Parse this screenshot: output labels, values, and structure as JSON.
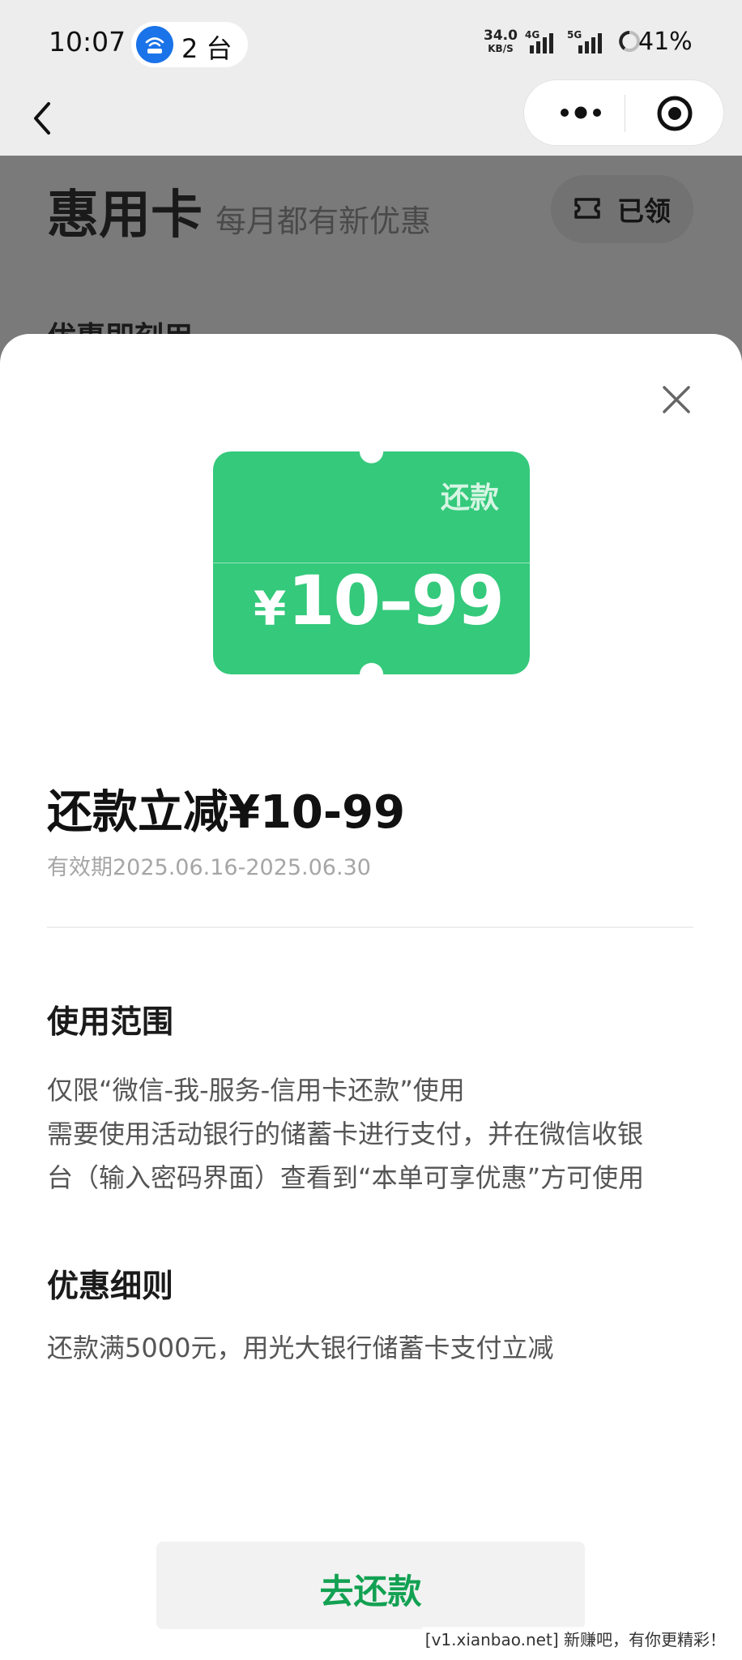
{
  "status_bar": {
    "time": "10:07",
    "device_count": "2 台",
    "net_speed_value": "34.0",
    "net_speed_unit": "KB/S",
    "sig1_label": "4G",
    "sig2_label": "5G",
    "battery": "41%"
  },
  "nav": {
    "back_icon": "chevron-left-icon",
    "more_icon": "more-dots-icon",
    "close_icon": "target-circle-icon"
  },
  "background_page": {
    "title": "惠用卡",
    "subtitle": "每月都有新优惠",
    "claimed_label": "已领",
    "section_partial": "优惠即刻用"
  },
  "sheet": {
    "coupon": {
      "tag": "还款",
      "currency": "¥",
      "amount": "10–99",
      "color": "#34c97b"
    },
    "title": "还款立减¥10-99",
    "validity": "有效期2025.06.16-2025.06.30",
    "scope": {
      "title": "使用范围",
      "lines": [
        "仅限“微信-我-服务-信用卡还款”使用",
        "需要使用活动银行的储蓄卡进行支付，并在微信收银",
        "台（输入密码界面）查看到“本单可享优惠”方可使用"
      ]
    },
    "rules": {
      "title": "优惠细则",
      "lines": [
        "还款满5000元，用光大银行储蓄卡支付立减"
      ]
    },
    "cta_label": "去还款",
    "accent_color": "#12a152"
  },
  "watermark": "[v1.xianbao.net] 新赚吧，有你更精彩！"
}
